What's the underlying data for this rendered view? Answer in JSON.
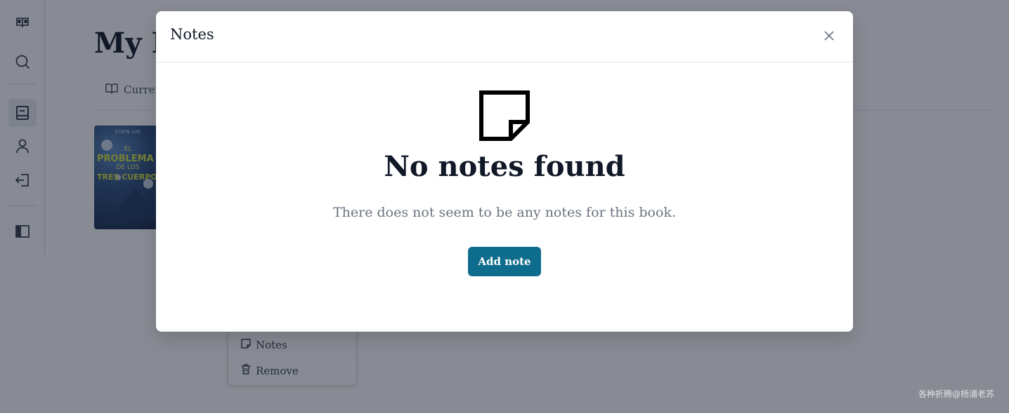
{
  "background": {
    "page_title": "My L",
    "tab_label": "Curren",
    "book": {
      "author": "CIXIN LIU",
      "title_line_el": "EL",
      "title_line_problema": "PROBLEMA",
      "title_line_delos": "DE LOS",
      "title_line_tres": "TRES CUERPOS"
    },
    "context_menu": {
      "items": [
        {
          "label": "Notes",
          "icon": "note-icon"
        },
        {
          "label": "Remove",
          "icon": "trash-icon"
        }
      ]
    },
    "sidebar_icons": [
      "logo-book-icon",
      "search-icon",
      "library-icon",
      "user-icon",
      "logout-icon",
      "sidebar-toggle-icon"
    ]
  },
  "modal": {
    "title": "Notes",
    "close_icon": "close-icon",
    "empty_state": {
      "icon": "sticky-note-icon",
      "heading": "No notes found",
      "description": "There does not seem to be any notes for this book.",
      "button_label": "Add note"
    }
  },
  "watermark": "各种折腾@杨浦老苏",
  "colors": {
    "primary_button": "#0e6d8c",
    "overlay": "rgba(17,24,39,0.5)",
    "text_muted": "#6b7280"
  }
}
